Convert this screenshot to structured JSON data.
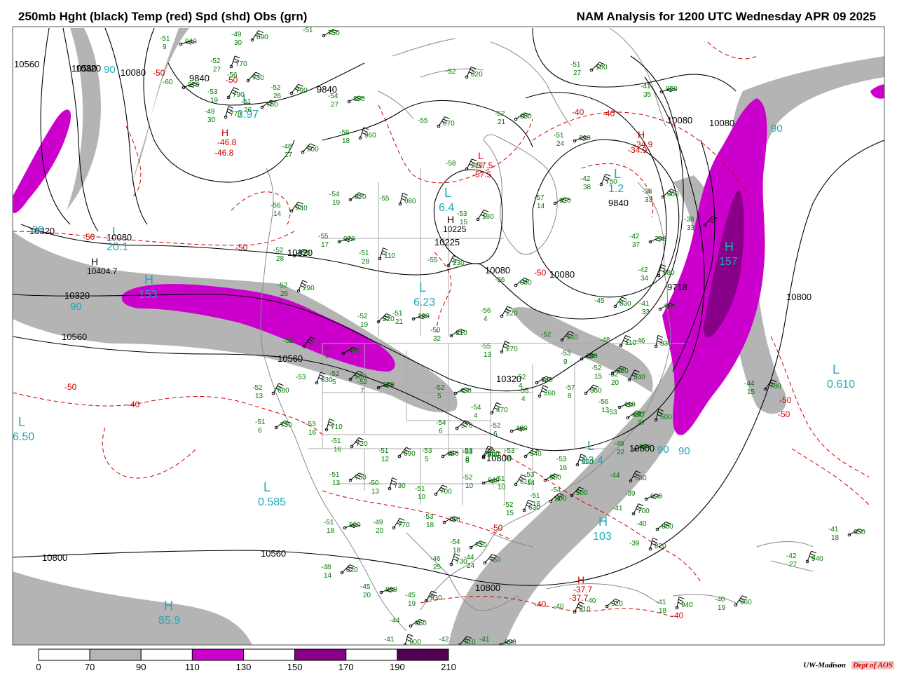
{
  "header": {
    "left_title": "250mb Hght (black) Temp (red) Spd (shd) Obs (grn)",
    "right_title": "NAM Analysis for 1200 UTC Wednesday  APR 09 2025"
  },
  "colors": {
    "height_contour": "#000000",
    "temperature_contour": "#cc0000",
    "observation": "#007a00",
    "pressure_centers": "#1fa8b8",
    "shade_70_90": "#b4b4b4",
    "shade_110_130": "#cc00cc",
    "shade_130_150": "#cc00cc",
    "shade_150_170": "#880088",
    "shade_190_210": "#550055",
    "geography": "#8a8a8a"
  },
  "colorbar": {
    "ticks": [
      "0",
      "70",
      "90",
      "110",
      "130",
      "150",
      "170",
      "190",
      "210"
    ],
    "segment_colors": [
      "#ffffff",
      "#b4b4b4",
      "#ffffff",
      "#cc00cc",
      "#ffffff",
      "#880088",
      "#ffffff",
      "#550055"
    ]
  },
  "credit": {
    "org": "UW-Madison",
    "dept": "Dept of AOS"
  },
  "height_labels": [
    "10560",
    "10320",
    "10080",
    "9840",
    "9840",
    "10320",
    "10080",
    "10320",
    "10080",
    "10080",
    "10225",
    "10080",
    "9840",
    "9718",
    "10080",
    "10320",
    "10800",
    "10560",
    "10560",
    "10320",
    "10800",
    "10560",
    "10800",
    "10800",
    "10800",
    "10560"
  ],
  "temperature_labels": [
    "-50",
    "-50",
    "-50",
    "-50",
    "-50",
    "-40",
    "-50",
    "-50",
    "-40",
    "-40",
    "-57.5",
    "-34.9",
    "-46.8",
    "-37.7",
    "-40",
    "-40",
    "-50",
    "-50"
  ],
  "centers": [
    {
      "letter": "L",
      "value": "20.1"
    },
    {
      "letter": "H",
      "value": "153"
    },
    {
      "letter": "L",
      "value": "6.4"
    },
    {
      "letter": "L",
      "value": "6.23"
    },
    {
      "letter": "L",
      "value": "0.585"
    },
    {
      "letter": "L",
      "value": "6.50"
    },
    {
      "letter": "H",
      "value": "85.9"
    },
    {
      "letter": "L",
      "value": "33.4"
    },
    {
      "letter": "H",
      "value": "103"
    },
    {
      "letter": "H",
      "value": "157"
    },
    {
      "letter": "L",
      "value": "0.610"
    },
    {
      "letter": "L",
      "value": "1.2"
    },
    {
      "letter": "L",
      "value": "3.97"
    }
  ],
  "extreme_markers": [
    {
      "letter": "H",
      "value": "-46.8"
    },
    {
      "letter": "H",
      "value": "-34.9"
    },
    {
      "letter": "H",
      "value": "-37.7"
    },
    {
      "letter": "L",
      "value": "-57.5"
    },
    {
      "letter": "H",
      "value": "10225"
    },
    {
      "letter": "H",
      "value": "10404.7"
    }
  ],
  "speed_labels": [
    "90",
    "90",
    "90",
    "90",
    "90",
    "90"
  ],
  "observations": [
    {
      "temp": "-51",
      "dewdep": "9",
      "hgt": "940"
    },
    {
      "temp": "-49",
      "dewdep": "30",
      "hgt": "890"
    },
    {
      "temp": "-51",
      "dewdep": "",
      "hgt": "750"
    },
    {
      "temp": "-52",
      "dewdep": "27",
      "hgt": "770"
    },
    {
      "temp": "-56",
      "dewdep": "",
      "hgt": "730"
    },
    {
      "temp": "-60",
      "dewdep": "",
      "hgt": "970"
    },
    {
      "temp": "-53",
      "dewdep": "19",
      "hgt": "790"
    },
    {
      "temp": "-51",
      "dewdep": "26",
      "hgt": "760"
    },
    {
      "temp": "-49",
      "dewdep": "30",
      "hgt": "770"
    },
    {
      "temp": "-52",
      "dewdep": "26",
      "hgt": "790"
    },
    {
      "temp": "-54",
      "dewdep": "27",
      "hgt": "890"
    },
    {
      "temp": "-52",
      "dewdep": "",
      "hgt": "020"
    },
    {
      "temp": "-51",
      "dewdep": "27",
      "hgt": "100"
    },
    {
      "temp": "-41",
      "dewdep": "35",
      "hgt": "850"
    },
    {
      "temp": "-55",
      "dewdep": "",
      "hgt": "070"
    },
    {
      "temp": "-52",
      "dewdep": "21",
      "hgt": "080"
    },
    {
      "temp": "-56",
      "dewdep": "18",
      "hgt": "960"
    },
    {
      "temp": "-48",
      "dewdep": "27",
      "hgt": "900"
    },
    {
      "temp": "-51",
      "dewdep": "24",
      "hgt": "820"
    },
    {
      "temp": "-58",
      "dewdep": "",
      "hgt": "210"
    },
    {
      "temp": "-54",
      "dewdep": "19",
      "hgt": "020"
    },
    {
      "temp": "-55",
      "dewdep": "",
      "hgt": "080"
    },
    {
      "temp": "-56",
      "dewdep": "14",
      "hgt": "940"
    },
    {
      "temp": "-57",
      "dewdep": "14",
      "hgt": "910"
    },
    {
      "temp": "-42",
      "dewdep": "38",
      "hgt": "750"
    },
    {
      "temp": "-38",
      "dewdep": "33",
      "hgt": "800"
    },
    {
      "temp": "-55",
      "dewdep": "17",
      "hgt": "070"
    },
    {
      "temp": "-53",
      "dewdep": "15",
      "hgt": "180"
    },
    {
      "temp": "-52",
      "dewdep": "28",
      "hgt": "030"
    },
    {
      "temp": "-51",
      "dewdep": "28",
      "hgt": "110"
    },
    {
      "temp": "-38",
      "dewdep": "33",
      "hgt": ""
    },
    {
      "temp": "-42",
      "dewdep": "37",
      "hgt": "790"
    },
    {
      "temp": "-55",
      "dewdep": "",
      "hgt": "230"
    },
    {
      "temp": "-56",
      "dewdep": "",
      "hgt": "090"
    },
    {
      "temp": "-42",
      "dewdep": "34",
      "hgt": "880"
    },
    {
      "temp": "-45",
      "dewdep": "",
      "hgt": "830"
    },
    {
      "temp": "-41",
      "dewdep": "33",
      "hgt": "980"
    },
    {
      "temp": "-52",
      "dewdep": "26",
      "hgt": "290"
    },
    {
      "temp": "-52",
      "dewdep": "19",
      "hgt": "220"
    },
    {
      "temp": "-51",
      "dewdep": "21",
      "hgt": "190"
    },
    {
      "temp": "-56",
      "dewdep": "4",
      "hgt": "220"
    },
    {
      "temp": "-50",
      "dewdep": "32",
      "hgt": "210"
    },
    {
      "temp": "-55",
      "dewdep": "13",
      "hgt": "270"
    },
    {
      "temp": "-52",
      "dewdep": "",
      "hgt": "140"
    },
    {
      "temp": "-53",
      "dewdep": "9",
      "hgt": "240"
    },
    {
      "temp": "-48",
      "dewdep": "",
      "hgt": "110"
    },
    {
      "temp": "-52",
      "dewdep": "15",
      "hgt": "290"
    },
    {
      "temp": "-46",
      "dewdep": "",
      "hgt": "330"
    },
    {
      "temp": "-52",
      "dewdep": "",
      "hgt": "520"
    },
    {
      "temp": "-52",
      "dewdep": "4",
      "hgt": "480"
    },
    {
      "temp": "-53",
      "dewdep": "",
      "hgt": "630"
    },
    {
      "temp": "-52",
      "dewdep": "5",
      "hgt": "580"
    },
    {
      "temp": "-52",
      "dewdep": "7",
      "hgt": "570"
    },
    {
      "temp": "-52",
      "dewdep": "13",
      "hgt": "680"
    },
    {
      "temp": "-51",
      "dewdep": "6",
      "hgt": "730"
    },
    {
      "temp": "-53",
      "dewdep": "16",
      "hgt": "710"
    },
    {
      "temp": "-51",
      "dewdep": "16",
      "hgt": "720"
    },
    {
      "temp": "-52",
      "dewdep": "5",
      "hgt": "450"
    },
    {
      "temp": "-54",
      "dewdep": "4",
      "hgt": "470"
    },
    {
      "temp": "-54",
      "dewdep": "6",
      "hgt": "570"
    },
    {
      "temp": "-52",
      "dewdep": "6",
      "hgt": "490"
    },
    {
      "temp": "-53",
      "dewdep": "8",
      "hgt": "560"
    },
    {
      "temp": "-52",
      "dewdep": "4",
      "hgt": "340"
    },
    {
      "temp": "-55",
      "dewdep": "4",
      "hgt": "360"
    },
    {
      "temp": "-57",
      "dewdep": "8",
      "hgt": "350"
    },
    {
      "temp": "-56",
      "dewdep": "13",
      "hgt": "410"
    },
    {
      "temp": "-52",
      "dewdep": "20",
      "hgt": "340"
    },
    {
      "temp": "-53",
      "dewdep": "",
      "hgt": "430"
    },
    {
      "temp": "-47",
      "dewdep": "27",
      "hgt": "500"
    },
    {
      "temp": "-51",
      "dewdep": "12",
      "hgt": "690"
    },
    {
      "temp": "-53",
      "dewdep": "5",
      "hgt": "640"
    },
    {
      "temp": "-53",
      "dewdep": "8",
      "hgt": "600"
    },
    {
      "temp": "-53",
      "dewdep": "9",
      "hgt": "540"
    },
    {
      "temp": "-52",
      "dewdep": "10",
      "hgt": "640"
    },
    {
      "temp": "-51",
      "dewdep": "10",
      "hgt": "610"
    },
    {
      "temp": "-53",
      "dewdep": "14",
      "hgt": "560"
    },
    {
      "temp": "-53",
      "dewdep": "16",
      "hgt": "520"
    },
    {
      "temp": "-54",
      "dewdep": "11",
      "hgt": "500"
    },
    {
      "temp": "-49",
      "dewdep": "22",
      "hgt": "560"
    },
    {
      "temp": "-44",
      "dewdep": "",
      "hgt": "580"
    },
    {
      "temp": "-51",
      "dewdep": "13",
      "hgt": "750"
    },
    {
      "temp": "-50",
      "dewdep": "13",
      "hgt": "730"
    },
    {
      "temp": "-51",
      "dewdep": "10",
      "hgt": "700"
    },
    {
      "temp": "-53",
      "dewdep": "18",
      "hgt": "710"
    },
    {
      "temp": "-52",
      "dewdep": "15",
      "hgt": "630"
    },
    {
      "temp": "-51",
      "dewdep": "16",
      "hgt": "600"
    },
    {
      "temp": "-51",
      "dewdep": "18",
      "hgt": "800"
    },
    {
      "temp": "-49",
      "dewdep": "20",
      "hgt": "770"
    },
    {
      "temp": "-54",
      "dewdep": "18",
      "hgt": "710"
    },
    {
      "temp": "-46",
      "dewdep": "25",
      "hgt": "730"
    },
    {
      "temp": "-44",
      "dewdep": "24",
      "hgt": "750"
    },
    {
      "temp": "-39",
      "dewdep": "",
      "hgt": "690"
    },
    {
      "temp": "-41",
      "dewdep": "",
      "hgt": "700"
    },
    {
      "temp": "-40",
      "dewdep": "",
      "hgt": "800"
    },
    {
      "temp": "-39",
      "dewdep": "",
      "hgt": "820"
    },
    {
      "temp": "-44",
      "dewdep": "15",
      "hgt": "780"
    },
    {
      "temp": "-41",
      "dewdep": "18",
      "hgt": "950"
    },
    {
      "temp": "-42",
      "dewdep": "27",
      "hgt": "940"
    },
    {
      "temp": "-48",
      "dewdep": "14",
      "hgt": "820"
    },
    {
      "temp": "-45",
      "dewdep": "20",
      "hgt": "820"
    },
    {
      "temp": "-45",
      "dewdep": "19",
      "hgt": "830"
    },
    {
      "temp": "-44",
      "dewdep": "",
      "hgt": "860"
    },
    {
      "temp": "-41",
      "dewdep": "",
      "hgt": "900"
    },
    {
      "temp": "-42",
      "dewdep": "",
      "hgt": "910"
    },
    {
      "temp": "-41",
      "dewdep": "",
      "hgt": "920"
    },
    {
      "temp": "-40",
      "dewdep": "",
      "hgt": "910"
    },
    {
      "temp": "-40",
      "dewdep": "",
      "hgt": "920"
    },
    {
      "temp": "-41",
      "dewdep": "18",
      "hgt": "940"
    },
    {
      "temp": "-40",
      "dewdep": "19",
      "hgt": "960"
    }
  ]
}
